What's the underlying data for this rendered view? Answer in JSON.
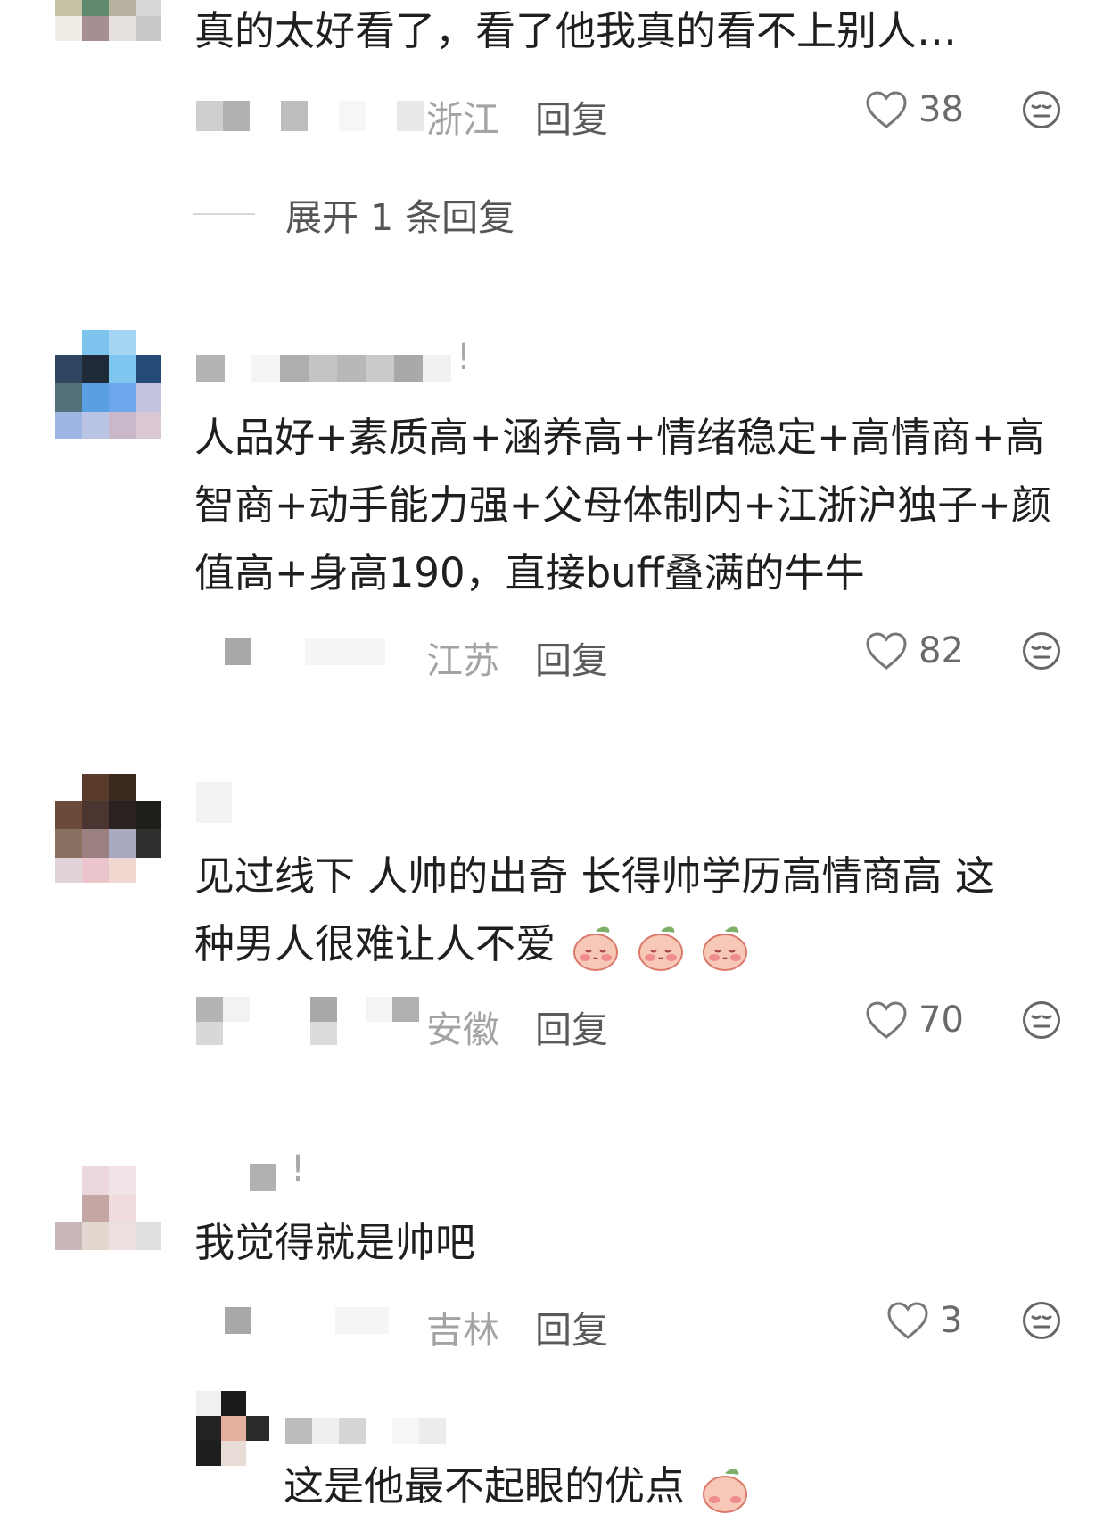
{
  "comments": [
    {
      "text": "真的太好看了，看了他我真的看不上别人…",
      "location": "浙江",
      "reply_label": "回复",
      "likes": "38"
    },
    {
      "expand_label": "展开 1 条回复"
    },
    {
      "username_suffix": "!",
      "text_lines": [
        "人品好+素质高+涵养高+情绪稳定+高情商+高",
        "智商+动手能力强+父母体制内+江浙沪独子+颜",
        "值高+身高190，直接buff叠满的牛牛"
      ],
      "location": "江苏",
      "reply_label": "回复",
      "likes": "82"
    },
    {
      "text_lines": [
        "见过线下 人帅的出奇 长得帅学历高情商高 这",
        "种男人很难让人不爱"
      ],
      "location": "安徽",
      "reply_label": "回复",
      "likes": "70"
    },
    {
      "username_suffix": "!",
      "text": "我觉得就是帅吧",
      "location": "吉林",
      "reply_label": "回复",
      "likes": "3"
    },
    {
      "text": "这是他最不起眼的优点"
    }
  ],
  "icons": {
    "like": "heart-outline-icon",
    "reaction": "neutral-face-icon",
    "sticker": "peach-blush-sticker"
  },
  "colors": {
    "text": "#1f1f1f",
    "meta": "#a3a3a3",
    "reply": "#5a5a5a"
  }
}
